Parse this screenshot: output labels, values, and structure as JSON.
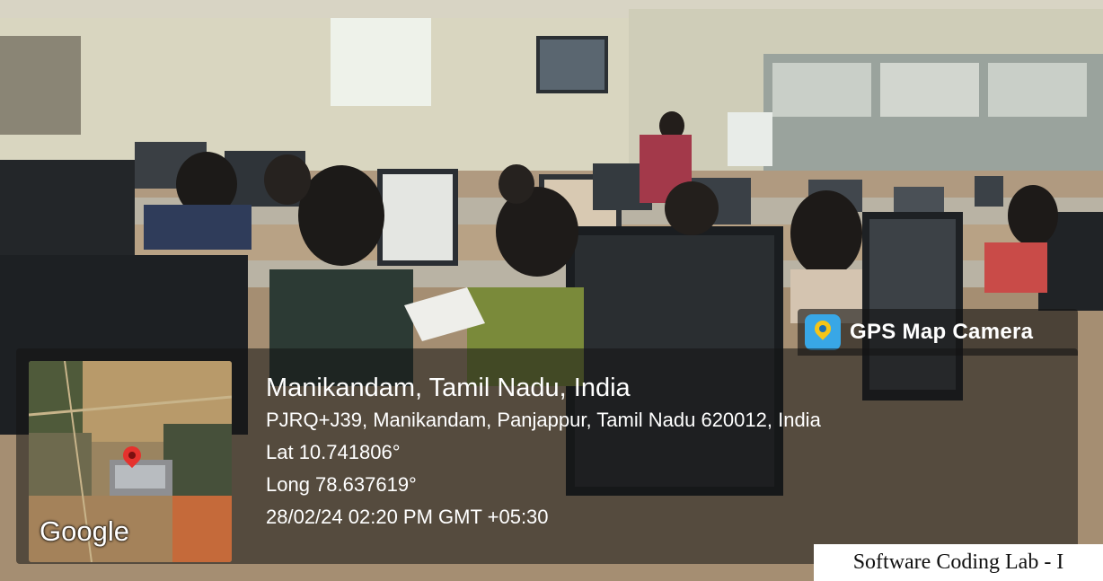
{
  "gps_badge": {
    "app_name": "GPS Map Camera",
    "icon": "gps-map-camera-icon"
  },
  "map": {
    "provider_label": "Google",
    "marker_icon": "location-pin-icon"
  },
  "location": {
    "place": "Manikandam, Tamil Nadu, India",
    "address": "PJRQ+J39, Manikandam, Panjappur, Tamil Nadu 620012, India",
    "latitude": "Lat 10.741806°",
    "longitude": "Long 78.637619°",
    "timestamp": "28/02/24 02:20 PM GMT +05:30"
  },
  "caption": "Software Coding Lab - I",
  "colors": {
    "overlay": "#141414",
    "app_icon": "#38a7e6",
    "map_marker": "#e5322d"
  }
}
